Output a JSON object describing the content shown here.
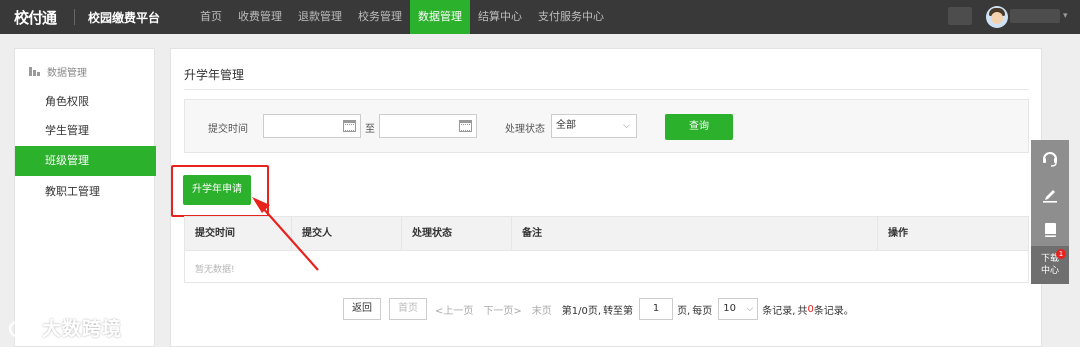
{
  "header": {
    "logo_text": "校付通",
    "platform_name": "校园缴费平台",
    "nav": [
      {
        "label": "首页"
      },
      {
        "label": "收费管理"
      },
      {
        "label": "退款管理"
      },
      {
        "label": "校务管理"
      },
      {
        "label": "数据管理",
        "active": true
      },
      {
        "label": "结算中心"
      },
      {
        "label": "支付服务中心"
      }
    ],
    "user_caret": "▾"
  },
  "sidebar": {
    "heading": "数据管理",
    "items": [
      {
        "label": "角色权限"
      },
      {
        "label": "学生管理"
      },
      {
        "label": "班级管理",
        "active": true
      },
      {
        "label": "教职工管理"
      }
    ]
  },
  "main": {
    "title": "升学年管理",
    "search": {
      "submit_time_label": "提交时间",
      "to_label": "至",
      "status_label": "处理状态",
      "status_value": "全部",
      "query_button": "查询"
    },
    "apply_button": "升学年申请",
    "table": {
      "columns": [
        "提交时间",
        "提交人",
        "处理状态",
        "备注",
        "操作"
      ],
      "empty_text": "暂无数据!"
    },
    "pager": {
      "back": "返回",
      "first": "首页",
      "prev": "<上一页",
      "next": "下一页>",
      "last": "末页",
      "page_info": "第1/0页,",
      "goto_prefix": "转至第",
      "goto_value": "1",
      "goto_suffix": "页,",
      "per_page_prefix": "每页",
      "per_page_value": "10",
      "per_page_suffix": "条记录,",
      "total_prefix": "共",
      "total_value": "0",
      "total_suffix": "条记录。"
    }
  },
  "floating_tools": {
    "download_label_line1": "下载",
    "download_label_line2": "中心",
    "download_badge": "1"
  },
  "watermark": {
    "text": "大数跨境"
  },
  "colors": {
    "brand_green": "#2cb12c",
    "topbar": "#393939",
    "highlight_red": "#e8231e"
  }
}
